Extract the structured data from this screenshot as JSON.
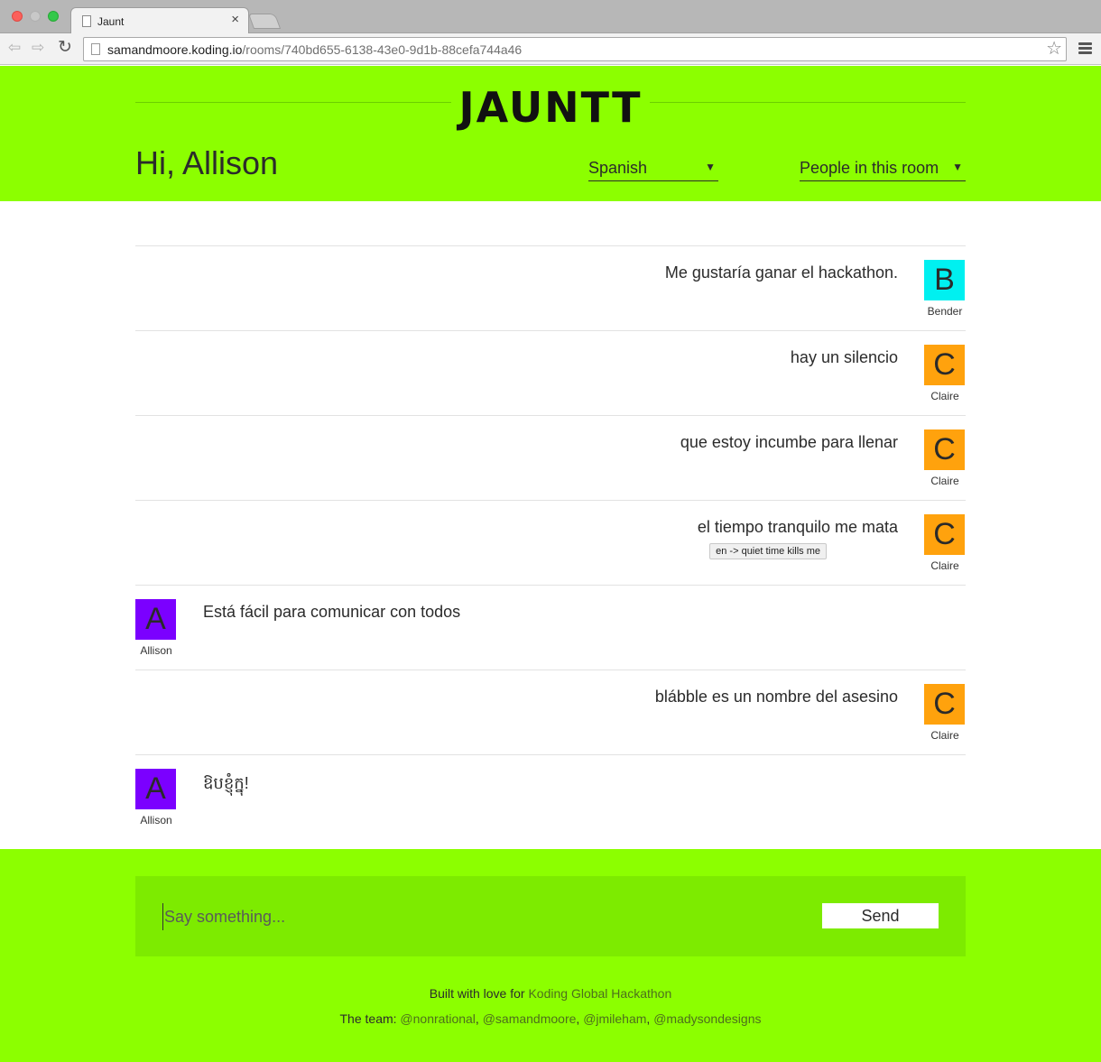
{
  "browser": {
    "tab_title": "Jaunt",
    "url_host": "samandmoore.koding.io",
    "url_path": "/rooms/740bd655-6138-43e0-9d1b-88cefa744a46"
  },
  "header": {
    "logo": "JAUNTT",
    "greeting": "Hi, Allison",
    "language_select": "Spanish",
    "people_select": "People in this room"
  },
  "messages": [
    {
      "side": "right",
      "text": "Me gustaría ganar el hackathon.",
      "initial": "B",
      "name": "Bender",
      "color": "#00f0f0"
    },
    {
      "side": "right",
      "text": "hay un silencio",
      "initial": "C",
      "name": "Claire",
      "color": "#ffa20d"
    },
    {
      "side": "right",
      "text": "que estoy incumbe para llenar",
      "initial": "C",
      "name": "Claire",
      "color": "#ffa20d"
    },
    {
      "side": "right",
      "text": "el tiempo tranquilo me mata",
      "initial": "C",
      "name": "Claire",
      "color": "#ffa20d",
      "translation": "en -> quiet time kills me"
    },
    {
      "side": "left",
      "text": "Está fácil para comunicar con todos",
      "initial": "A",
      "name": "Allison",
      "color": "#7b00ff"
    },
    {
      "side": "right",
      "text": "blábble es un nombre del asesino",
      "initial": "C",
      "name": "Claire",
      "color": "#ffa20d"
    },
    {
      "side": "left",
      "text": "ឱបខ្ញុំក្នុ!",
      "initial": "A",
      "name": "Allison",
      "color": "#7b00ff"
    }
  ],
  "compose": {
    "placeholder": "Say something...",
    "send_label": "Send"
  },
  "footer": {
    "built_prefix": "Built with love for ",
    "built_link": "Koding Global Hackathon",
    "team_prefix": "The team: ",
    "team_members": [
      "@nonrational",
      "@samandmoore",
      "@jmileham",
      "@madysondesigns"
    ],
    "separator": ", "
  },
  "colors": {
    "brand_green": "#8cff00",
    "compose_green": "#7deb00",
    "bender": "#00f0f0",
    "claire": "#ffa20d",
    "allison": "#7b00ff"
  }
}
